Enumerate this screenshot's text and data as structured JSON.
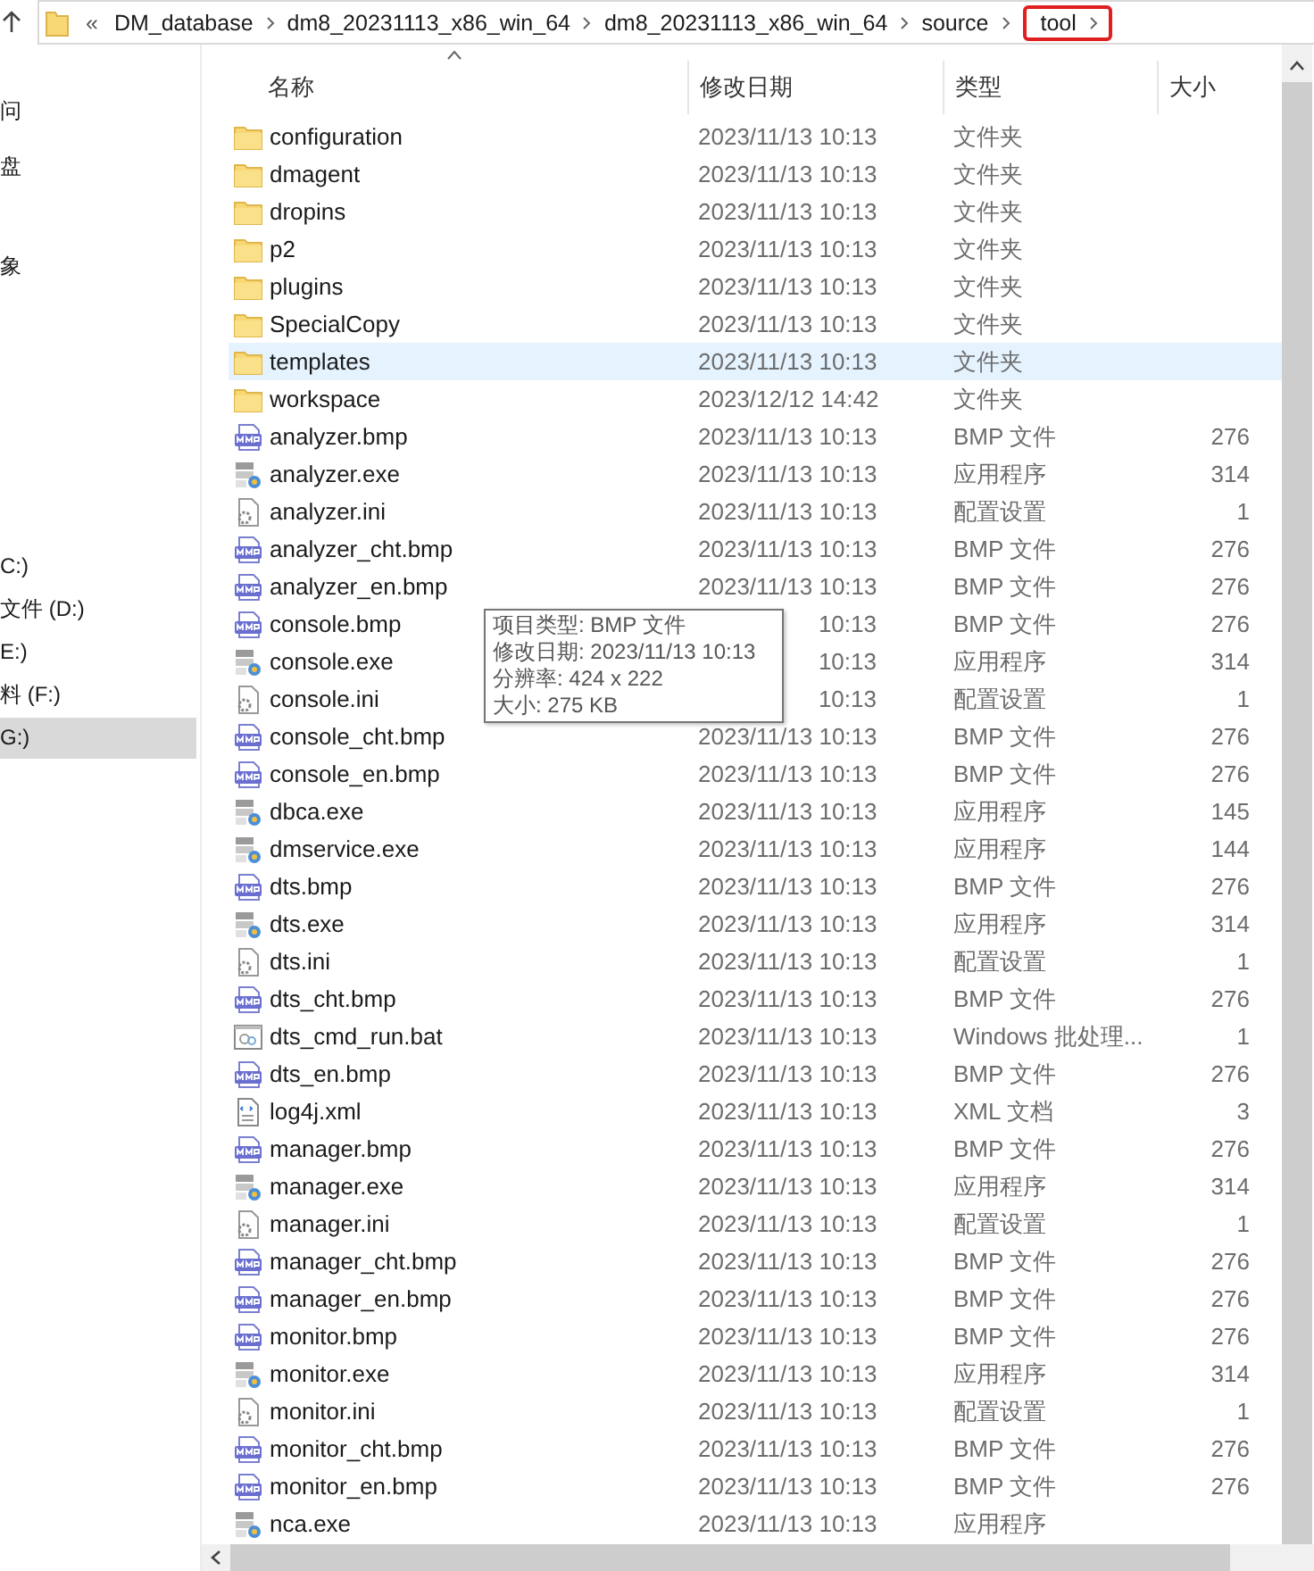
{
  "address_bar": {
    "overflow": "«",
    "crumbs": [
      {
        "label": "DM_database",
        "highlighted": false
      },
      {
        "label": "dm8_20231113_x86_win_64",
        "highlighted": false
      },
      {
        "label": "dm8_20231113_x86_win_64",
        "highlighted": false
      },
      {
        "label": "source",
        "highlighted": false
      },
      {
        "label": "tool",
        "highlighted": true
      }
    ]
  },
  "sidebar": {
    "items": [
      {
        "label": "问",
        "selected": false
      },
      {
        "label": "盘",
        "selected": false
      },
      {
        "label": "象",
        "selected": false
      },
      {
        "label": "C:)",
        "selected": false
      },
      {
        "label": "文件 (D:)",
        "selected": false
      },
      {
        "label": "E:)",
        "selected": false
      },
      {
        "label": "料 (F:)",
        "selected": false
      },
      {
        "label": "G:)",
        "selected": true
      }
    ]
  },
  "table": {
    "columns": [
      "名称",
      "修改日期",
      "类型",
      "大小"
    ],
    "rows": [
      {
        "kind": "folder",
        "name": "configuration",
        "date": "2023/11/13 10:13",
        "type": "文件夹",
        "selected": false
      },
      {
        "kind": "folder",
        "name": "dmagent",
        "date": "2023/11/13 10:13",
        "type": "文件夹",
        "selected": false
      },
      {
        "kind": "folder",
        "name": "dropins",
        "date": "2023/11/13 10:13",
        "type": "文件夹",
        "selected": false
      },
      {
        "kind": "folder",
        "name": "p2",
        "date": "2023/11/13 10:13",
        "type": "文件夹",
        "selected": false
      },
      {
        "kind": "folder",
        "name": "plugins",
        "date": "2023/11/13 10:13",
        "type": "文件夹",
        "selected": false
      },
      {
        "kind": "folder",
        "name": "SpecialCopy",
        "date": "2023/11/13 10:13",
        "type": "文件夹",
        "selected": false
      },
      {
        "kind": "folder",
        "name": "templates",
        "date": "2023/11/13 10:13",
        "type": "文件夹",
        "selected": true
      },
      {
        "kind": "folder",
        "name": "workspace",
        "date": "2023/12/12 14:42",
        "type": "文件夹",
        "selected": false
      },
      {
        "kind": "bmp",
        "name": "analyzer.bmp",
        "date": "2023/11/13 10:13",
        "type": "BMP 文件",
        "size": "276",
        "selected": false
      },
      {
        "kind": "exe",
        "name": "analyzer.exe",
        "date": "2023/11/13 10:13",
        "type": "应用程序",
        "size": "314",
        "selected": false
      },
      {
        "kind": "ini",
        "name": "analyzer.ini",
        "date": "2023/11/13 10:13",
        "type": "配置设置",
        "size": "1",
        "selected": false
      },
      {
        "kind": "bmp",
        "name": "analyzer_cht.bmp",
        "date": "2023/11/13 10:13",
        "type": "BMP 文件",
        "size": "276",
        "selected": false
      },
      {
        "kind": "bmp",
        "name": "analyzer_en.bmp",
        "date": "2023/11/13 10:13",
        "type": "BMP 文件",
        "size": "276",
        "selected": false
      },
      {
        "kind": "bmp",
        "name": "console.bmp",
        "date": "10:13",
        "date_partly_hidden": true,
        "type": "BMP 文件",
        "size": "276",
        "selected": false
      },
      {
        "kind": "exe",
        "name": "console.exe",
        "date": "10:13",
        "date_partly_hidden": true,
        "type": "应用程序",
        "size": "314",
        "selected": false
      },
      {
        "kind": "ini",
        "name": "console.ini",
        "date": "10:13",
        "date_partly_hidden": true,
        "type": "配置设置",
        "size": "1",
        "selected": false
      },
      {
        "kind": "bmp",
        "name": "console_cht.bmp",
        "date": "2023/11/13 10:13",
        "type": "BMP 文件",
        "size": "276",
        "selected": false
      },
      {
        "kind": "bmp",
        "name": "console_en.bmp",
        "date": "2023/11/13 10:13",
        "type": "BMP 文件",
        "size": "276",
        "selected": false
      },
      {
        "kind": "exe",
        "name": "dbca.exe",
        "date": "2023/11/13 10:13",
        "type": "应用程序",
        "size": "145",
        "selected": false
      },
      {
        "kind": "exe",
        "name": "dmservice.exe",
        "date": "2023/11/13 10:13",
        "type": "应用程序",
        "size": "144",
        "selected": false
      },
      {
        "kind": "bmp",
        "name": "dts.bmp",
        "date": "2023/11/13 10:13",
        "type": "BMP 文件",
        "size": "276",
        "selected": false
      },
      {
        "kind": "exe",
        "name": "dts.exe",
        "date": "2023/11/13 10:13",
        "type": "应用程序",
        "size": "314",
        "selected": false
      },
      {
        "kind": "ini",
        "name": "dts.ini",
        "date": "2023/11/13 10:13",
        "type": "配置设置",
        "size": "1",
        "selected": false
      },
      {
        "kind": "bmp",
        "name": "dts_cht.bmp",
        "date": "2023/11/13 10:13",
        "type": "BMP 文件",
        "size": "276",
        "selected": false
      },
      {
        "kind": "bat",
        "name": "dts_cmd_run.bat",
        "date": "2023/11/13 10:13",
        "type": "Windows 批处理...",
        "size": "1",
        "selected": false
      },
      {
        "kind": "bmp",
        "name": "dts_en.bmp",
        "date": "2023/11/13 10:13",
        "type": "BMP 文件",
        "size": "276",
        "selected": false
      },
      {
        "kind": "xml",
        "name": "log4j.xml",
        "date": "2023/11/13 10:13",
        "type": "XML 文档",
        "size": "3",
        "selected": false
      },
      {
        "kind": "bmp",
        "name": "manager.bmp",
        "date": "2023/11/13 10:13",
        "type": "BMP 文件",
        "size": "276",
        "selected": false
      },
      {
        "kind": "exe",
        "name": "manager.exe",
        "date": "2023/11/13 10:13",
        "type": "应用程序",
        "size": "314",
        "selected": false
      },
      {
        "kind": "ini",
        "name": "manager.ini",
        "date": "2023/11/13 10:13",
        "type": "配置设置",
        "size": "1",
        "selected": false
      },
      {
        "kind": "bmp",
        "name": "manager_cht.bmp",
        "date": "2023/11/13 10:13",
        "type": "BMP 文件",
        "size": "276",
        "selected": false
      },
      {
        "kind": "bmp",
        "name": "manager_en.bmp",
        "date": "2023/11/13 10:13",
        "type": "BMP 文件",
        "size": "276",
        "selected": false
      },
      {
        "kind": "bmp",
        "name": "monitor.bmp",
        "date": "2023/11/13 10:13",
        "type": "BMP 文件",
        "size": "276",
        "selected": false
      },
      {
        "kind": "exe",
        "name": "monitor.exe",
        "date": "2023/11/13 10:13",
        "type": "应用程序",
        "size": "314",
        "selected": false
      },
      {
        "kind": "ini",
        "name": "monitor.ini",
        "date": "2023/11/13 10:13",
        "type": "配置设置",
        "size": "1",
        "selected": false
      },
      {
        "kind": "bmp",
        "name": "monitor_cht.bmp",
        "date": "2023/11/13 10:13",
        "type": "BMP 文件",
        "size": "276",
        "selected": false
      },
      {
        "kind": "bmp",
        "name": "monitor_en.bmp",
        "date": "2023/11/13 10:13",
        "type": "BMP 文件",
        "size": "276",
        "selected": false
      },
      {
        "kind": "exe",
        "name": "nca.exe",
        "date": "2023/11/13 10:13",
        "type": "应用程序",
        "selected": false
      }
    ]
  },
  "tooltip": {
    "lines": [
      "项目类型: BMP 文件",
      "修改日期: 2023/11/13 10:13",
      "分辨率: 424 x 222",
      "大小: 275 KB"
    ]
  }
}
